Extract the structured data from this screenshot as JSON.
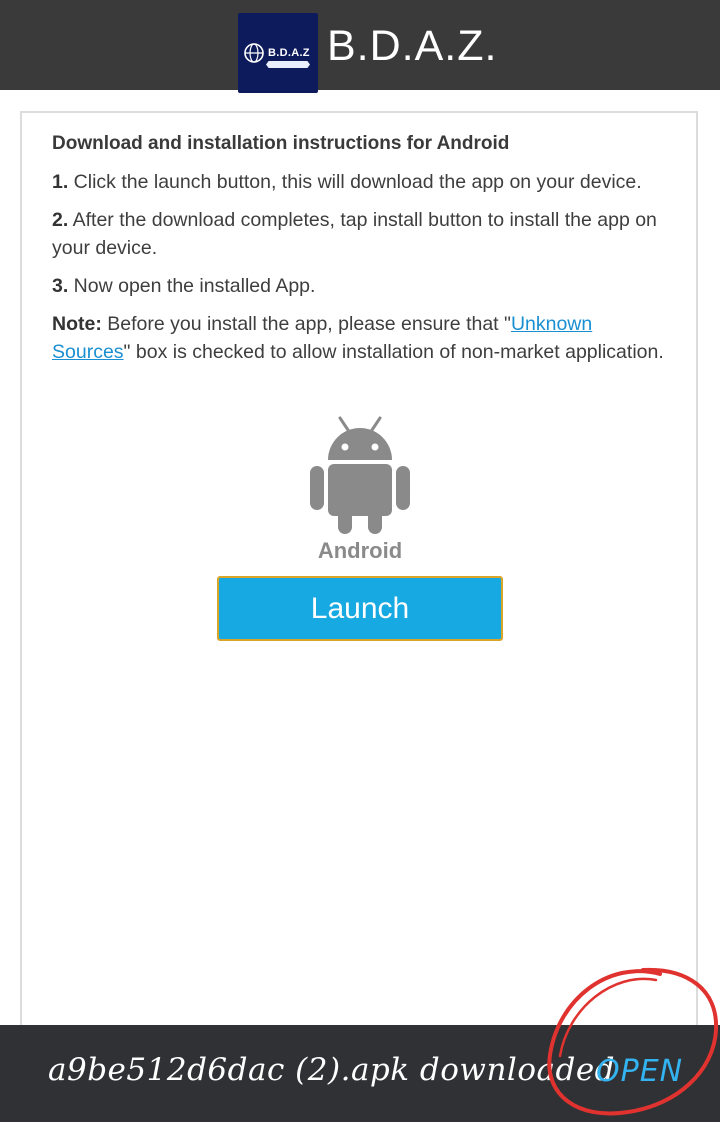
{
  "header": {
    "brand": "B.D.A.Z.",
    "logo_text": "B.D.A.Z",
    "logo_icon": "bdaz-logo-icon",
    "background": "#3a3a3a"
  },
  "instructions": {
    "title": "Download and installation instructions for Android",
    "steps": [
      {
        "num": "1.",
        "text": " Click the launch button, this will download the app on your device."
      },
      {
        "num": "2.",
        "text": " After the download completes, tap install button to install the app on your device."
      },
      {
        "num": "3.",
        "text": " Now open the installed App."
      }
    ],
    "note_label": "Note:",
    "note_before": " Before you install the app, please ensure that \"",
    "note_link": "Unknown Sources",
    "note_after": "\" box is checked to allow installation of non-market application."
  },
  "platform": {
    "icon": "android-robot-icon",
    "label": "Android"
  },
  "launch_button": {
    "label": "Launch",
    "color": "#17a9e1",
    "border_color": "#d9a62a"
  },
  "download_bar": {
    "message": "a9be512d6dac (2).apk downloaded",
    "action": "OPEN",
    "action_color": "#33b4f0",
    "annotation_color": "#e0322f"
  }
}
